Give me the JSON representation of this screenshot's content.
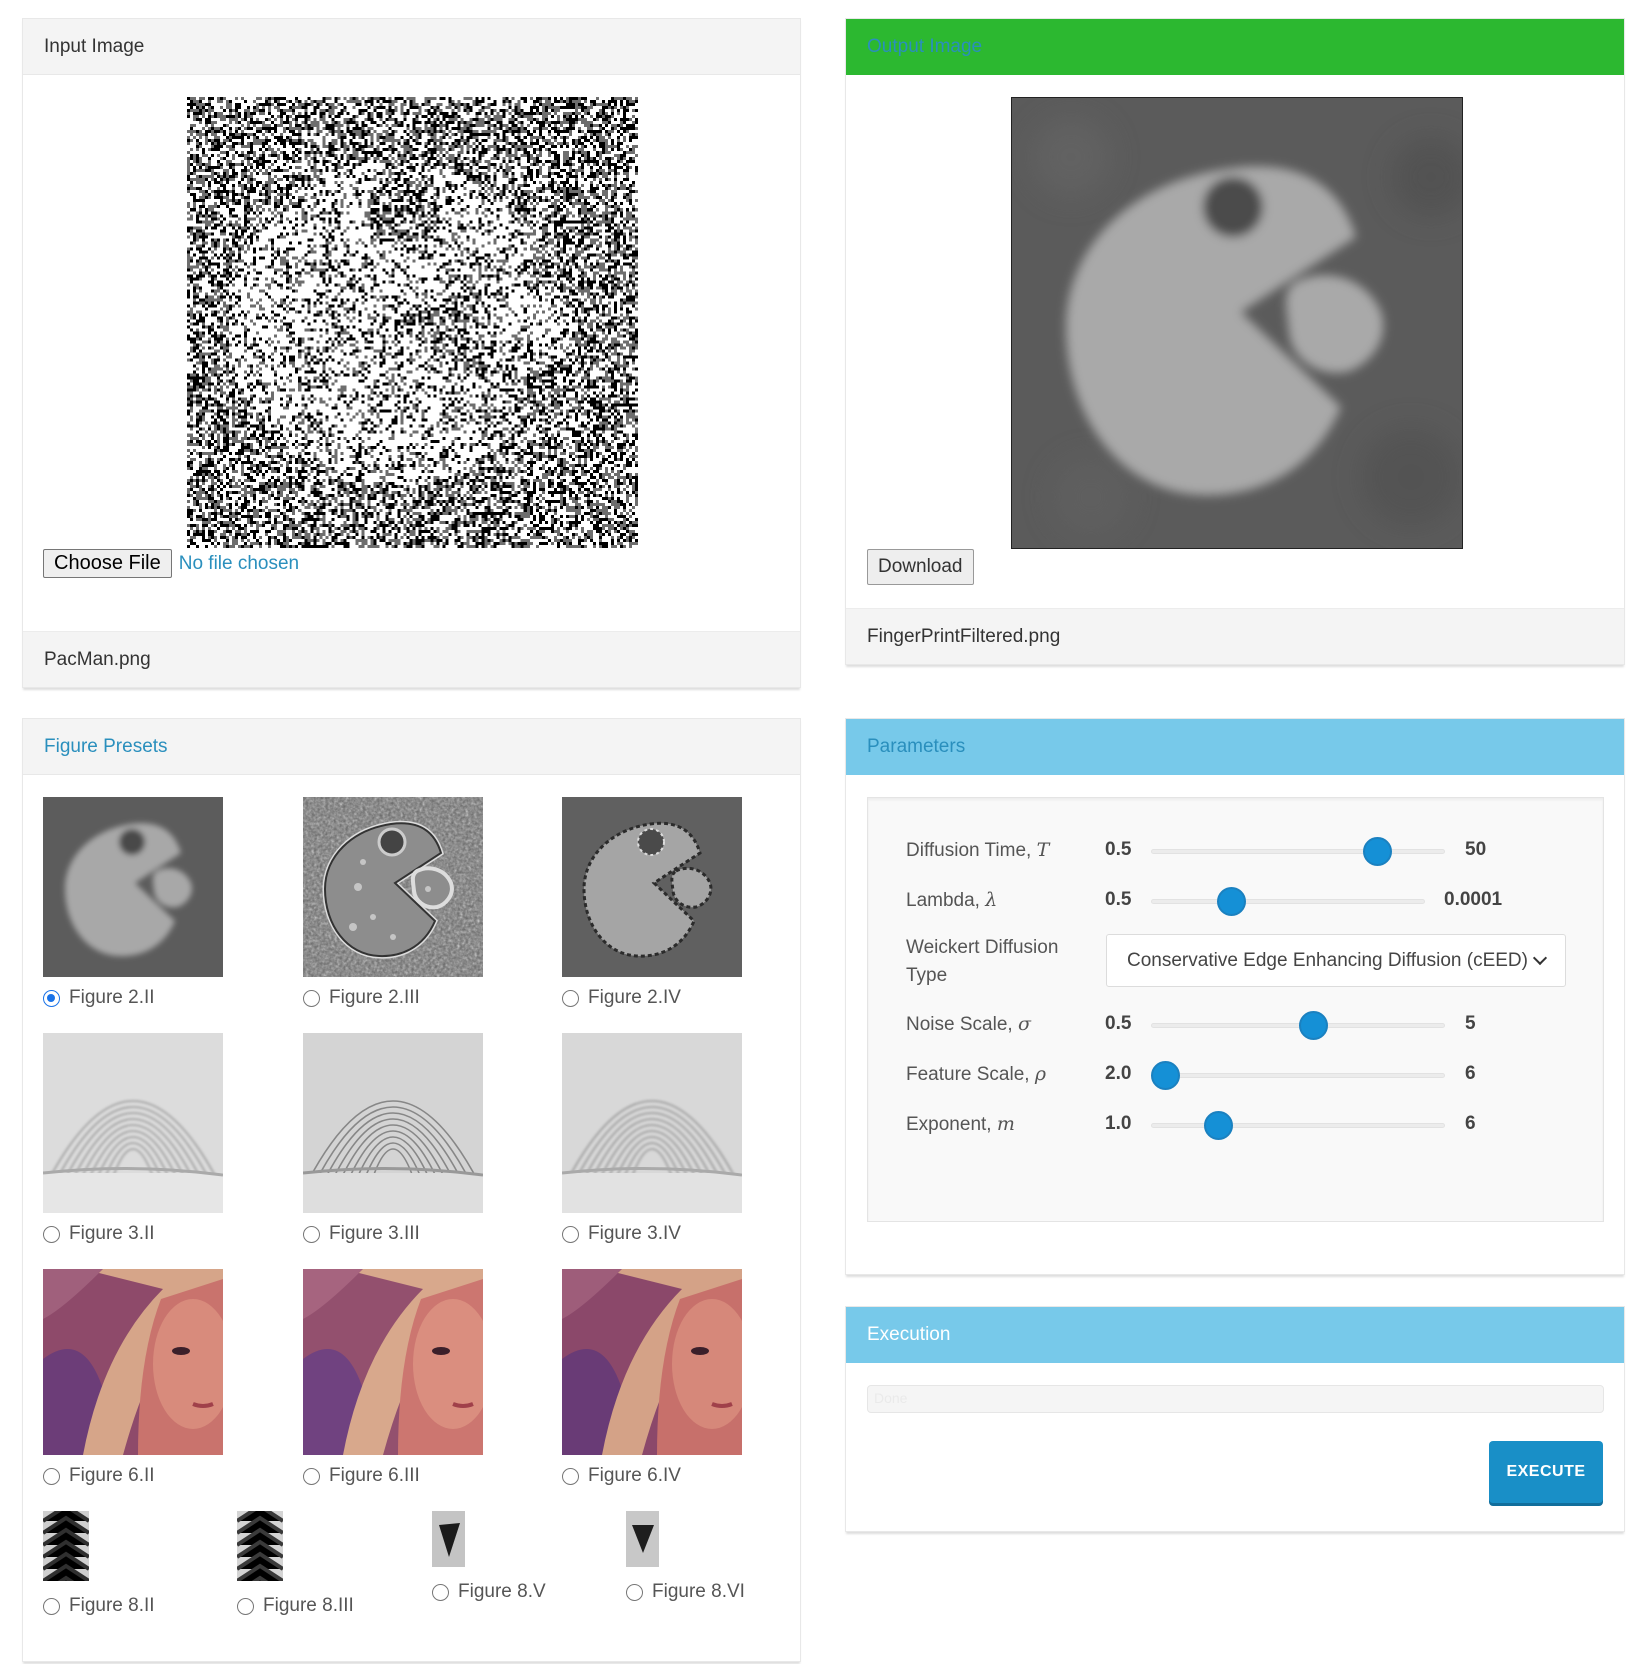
{
  "input_panel": {
    "title": "Input Image",
    "choose_file_label": "Choose File",
    "no_file_text": "No file chosen",
    "filename": "PacMan.png"
  },
  "output_panel": {
    "title": "Output Image",
    "download_label": "Download",
    "filename": "FingerPrintFiltered.png",
    "header_color": "#2cb830"
  },
  "presets_panel": {
    "title": "Figure Presets",
    "items": [
      {
        "label": "Figure 2.II",
        "selected": true
      },
      {
        "label": "Figure 2.III",
        "selected": false
      },
      {
        "label": "Figure 2.IV",
        "selected": false
      },
      {
        "label": "Figure 3.II",
        "selected": false
      },
      {
        "label": "Figure 3.III",
        "selected": false
      },
      {
        "label": "Figure 3.IV",
        "selected": false
      },
      {
        "label": "Figure 6.II",
        "selected": false
      },
      {
        "label": "Figure 6.III",
        "selected": false
      },
      {
        "label": "Figure 6.IV",
        "selected": false
      },
      {
        "label": "Figure 8.II",
        "selected": false
      },
      {
        "label": "Figure 8.III",
        "selected": false
      },
      {
        "label": "Figure 8.V",
        "selected": false
      },
      {
        "label": "Figure 8.VI",
        "selected": false
      }
    ]
  },
  "parameters_panel": {
    "title": "Parameters",
    "diffusion_time": {
      "label": "Diffusion Time, ",
      "symbol": "T",
      "min": "0.5",
      "max": "50",
      "level": 0.8
    },
    "lambda": {
      "label": "Lambda, ",
      "symbol": "λ",
      "min": "0.5",
      "max": "0.0001",
      "level": 0.27
    },
    "weickert_type": {
      "label": "Weickert Diffusion Type",
      "value": "Conservative Edge Enhancing Diffusion (cEED)"
    },
    "noise_scale": {
      "label": "Noise Scale, ",
      "symbol": "σ",
      "min": "0.5",
      "max": "5",
      "level": 0.56
    },
    "feature_scale": {
      "label": "Feature Scale, ",
      "symbol": "ρ",
      "min": "2.0",
      "max": "6",
      "level": 0.0
    },
    "exponent": {
      "label": "Exponent, ",
      "symbol": "m",
      "min": "1.0",
      "max": "6",
      "level": 0.2
    }
  },
  "execution_panel": {
    "title": "Execution",
    "progress_text": "Done",
    "execute_label": "EXECUTE"
  },
  "colors": {
    "accent": "#2a8fbd",
    "panel_header_blue": "#77c9ea",
    "slider_knob": "#1590d6"
  }
}
